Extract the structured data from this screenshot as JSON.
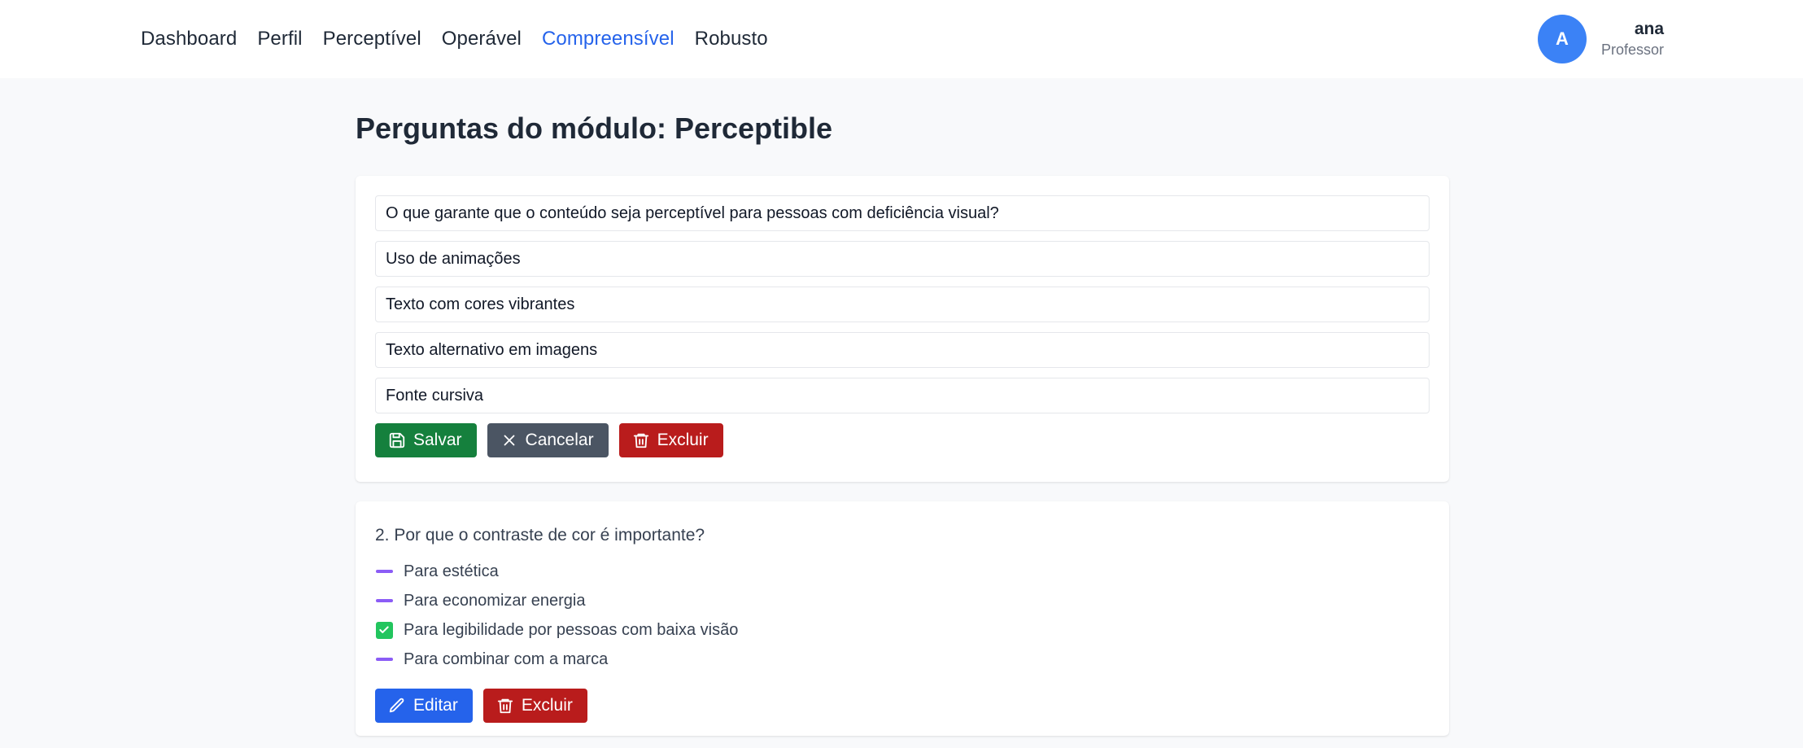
{
  "nav": {
    "items": [
      {
        "label": "Dashboard",
        "active": false
      },
      {
        "label": "Perfil",
        "active": false
      },
      {
        "label": "Perceptível",
        "active": false
      },
      {
        "label": "Operável",
        "active": false
      },
      {
        "label": "Compreensível",
        "active": true
      },
      {
        "label": "Robusto",
        "active": false
      }
    ]
  },
  "user": {
    "initial": "A",
    "name": "ana",
    "role": "Professor"
  },
  "page": {
    "title": "Perguntas do módulo: Perceptible"
  },
  "edit_card": {
    "question_value": "O que garante que o conteúdo seja perceptível para pessoas com deficiência visual?",
    "options": [
      "Uso de animações",
      "Texto com cores vibrantes",
      "Texto alternativo em imagens",
      "Fonte cursiva"
    ],
    "save_label": "Salvar",
    "cancel_label": "Cancelar",
    "delete_label": "Excluir"
  },
  "question_card": {
    "question": "2. Por que o contraste de cor é importante?",
    "options": [
      {
        "label": "Para estética",
        "correct": false
      },
      {
        "label": "Para economizar energia",
        "correct": false
      },
      {
        "label": "Para legibilidade por pessoas com baixa visão",
        "correct": true
      },
      {
        "label": "Para combinar com a marca",
        "correct": false
      }
    ],
    "edit_label": "Editar",
    "delete_label": "Excluir"
  },
  "colors": {
    "accent": "#2563eb",
    "save": "#15803d",
    "cancel": "#4b5563",
    "delete": "#b91c1c",
    "incorrect_marker": "#8b5cf6",
    "correct_marker": "#22c55e"
  },
  "icons": {
    "save": "save-icon",
    "cancel": "close-icon",
    "delete": "trash-icon",
    "edit": "pencil-icon",
    "incorrect": "dash-icon",
    "correct": "check-icon"
  }
}
